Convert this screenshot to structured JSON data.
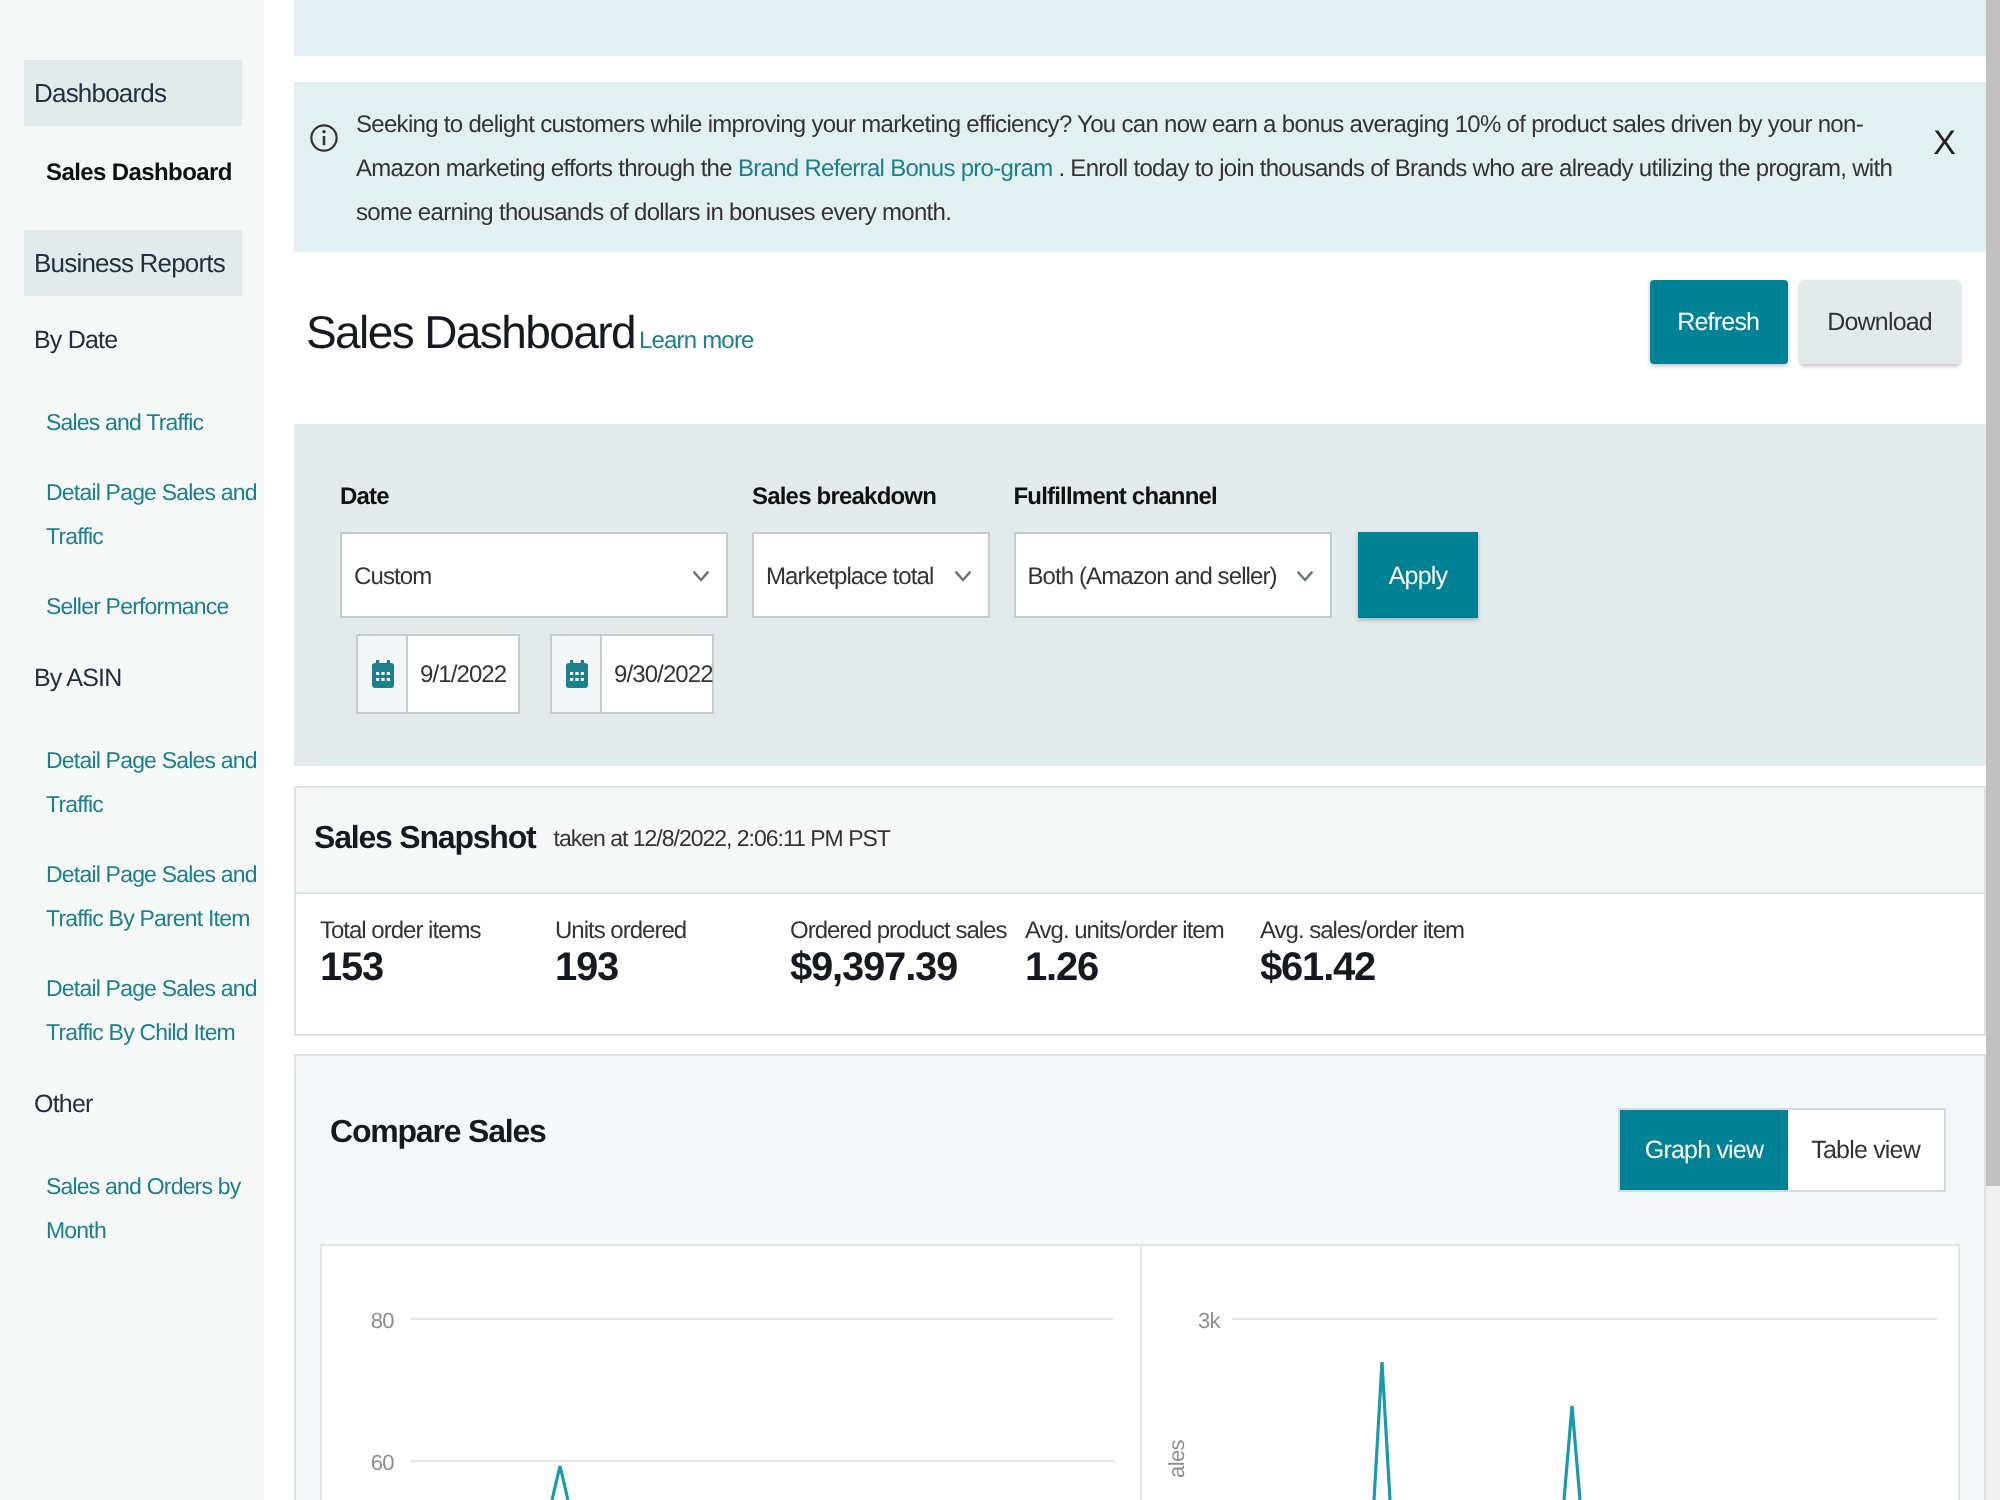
{
  "sidebar": [
    {
      "title": "Dashboards",
      "groups": [
        {
          "links": [
            {
              "label": "Sales Dashboard",
              "selected": true
            }
          ]
        }
      ]
    },
    {
      "title": "Business Reports",
      "groups": [
        {
          "title": "By Date",
          "links": [
            {
              "label": "Sales and Traffic",
              "selected": false
            },
            {
              "label": "Detail Page Sales and Traffic",
              "selected": false
            },
            {
              "label": "Seller Performance",
              "selected": false
            }
          ]
        },
        {
          "title": "By ASIN",
          "links": [
            {
              "label": "Detail Page Sales and Traffic",
              "selected": false
            },
            {
              "label": "Detail Page Sales and Traffic By Parent Item",
              "selected": false
            },
            {
              "label": "Detail Page Sales and Traffic By Child Item",
              "selected": false
            }
          ]
        },
        {
          "title": "Other",
          "links": [
            {
              "label": "Sales and Orders by Month",
              "selected": false
            }
          ]
        }
      ]
    }
  ],
  "notice": {
    "text": "Seeking to delight customers while improving your marketing efficiency? You can now earn a bonus averaging 10% of product sales driven by your non-Amazon marketing efforts through the ",
    "link": "Brand Referral Bonus pro-gram",
    "text_after": " . Enroll today to join thousands of Brands who are already utilizing the program, with some earning thousands of dollars in bonuses every month.",
    "close": "X"
  },
  "header": {
    "title": "Sales Dashboard",
    "learn_more": "Learn more",
    "buttons": [
      {
        "label": "Refresh",
        "kind": "primary"
      },
      {
        "label": "Download",
        "kind": "secondary"
      }
    ]
  },
  "filters": {
    "fields": [
      {
        "label": "Date",
        "value": "Custom"
      },
      {
        "label": "Sales breakdown",
        "value": "Marketplace total"
      },
      {
        "label": "Fulfillment channel",
        "value": "Both (Amazon and seller)"
      }
    ],
    "apply": "Apply",
    "date_range": [
      "9/1/2022",
      "9/30/2022"
    ]
  },
  "snapshot": {
    "title": "Sales Snapshot",
    "taken_at": "taken at 12/8/2022, 2:06:11 PM PST",
    "metrics": [
      {
        "label": "Total order items",
        "value": "153"
      },
      {
        "label": "Units ordered",
        "value": "193"
      },
      {
        "label": "Ordered product sales",
        "value": "$9,397.39"
      },
      {
        "label": "Avg. units/order item",
        "value": "1.26"
      },
      {
        "label": "Avg. sales/order item",
        "value": "$61.42"
      }
    ]
  },
  "compare": {
    "title": "Compare Sales",
    "views": [
      {
        "label": "Graph view",
        "selected": true
      },
      {
        "label": "Table view",
        "selected": false
      }
    ],
    "charts": [
      {
        "y_tick_labels": [
          "80",
          "60"
        ]
      },
      {
        "y_tick_labels": [
          "3k"
        ],
        "y_axis_label": "ales"
      }
    ]
  }
}
